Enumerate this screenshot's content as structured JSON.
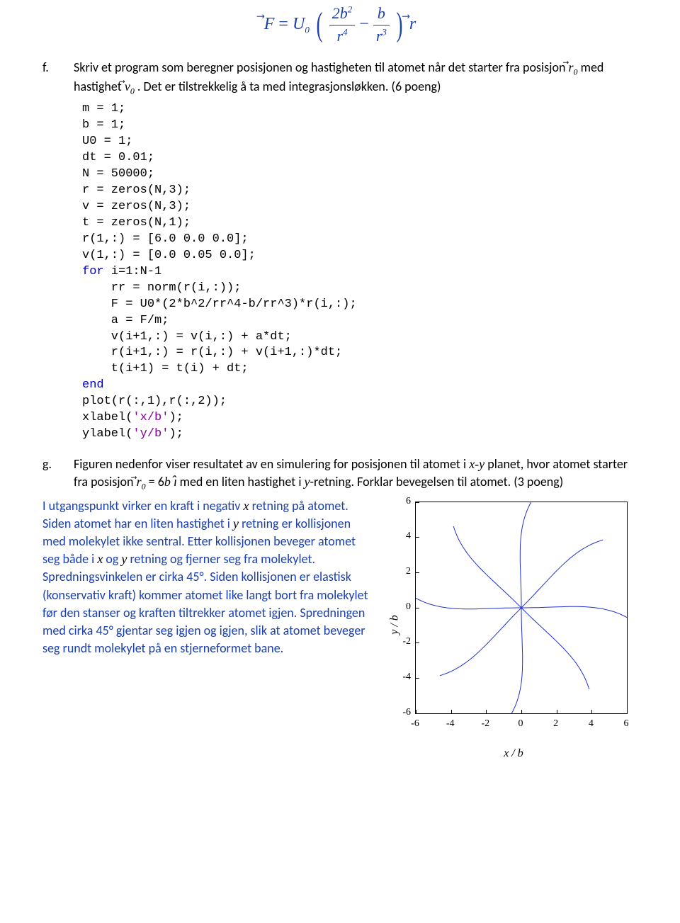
{
  "formula": {
    "lhs_var": "F",
    "coeff": "U",
    "coeff_sub": "0",
    "frac1_num": "2b",
    "frac1_num_sup": "2",
    "frac1_den_base": "r",
    "frac1_den_sup": "4",
    "frac2_num": "b",
    "frac2_den_base": "r",
    "frac2_den_sup": "3",
    "rhs_var": "r"
  },
  "item_f": {
    "letter": "f.",
    "text_1": "Skriv et program som beregner posisjonen og hastigheten til atomet når det starter fra posisjon ",
    "r_sym": "r",
    "r_sub": "0",
    "text_2": " med hastighet ",
    "v_sym": "v",
    "v_sub": "0",
    "text_3": ". Det er tilstrekkelig å ta med integrasjonsløkken. (6 poeng)"
  },
  "code": {
    "lines": [
      {
        "t": "m = 1;"
      },
      {
        "t": "b = 1;"
      },
      {
        "t": "U0 = 1;"
      },
      {
        "t": "dt = 0.01;"
      },
      {
        "t": "N = 50000;"
      },
      {
        "t": "r = zeros(N,3);"
      },
      {
        "t": "v = zeros(N,3);"
      },
      {
        "t": "t = zeros(N,1);"
      },
      {
        "t": "r(1,:) = [6.0 0.0 0.0];"
      },
      {
        "t": "v(1,:) = [0.0 0.05 0.0];"
      },
      {
        "pre": "",
        "kw": "for",
        "post": " i=1:N-1"
      },
      {
        "indent": 1,
        "t": "rr = norm(r(i,:));"
      },
      {
        "indent": 1,
        "t": "F = U0*(2*b^2/rr^4-b/rr^3)*r(i,:);"
      },
      {
        "indent": 1,
        "t": "a = F/m;"
      },
      {
        "indent": 1,
        "t": "v(i+1,:) = v(i,:) + a*dt;"
      },
      {
        "indent": 1,
        "t": "r(i+1,:) = r(i,:) + v(i+1,:)*dt;"
      },
      {
        "indent": 1,
        "t": "t(i+1) = t(i) + dt;"
      },
      {
        "kw": "end"
      },
      {
        "t": "plot(r(:,1),r(:,2));"
      },
      {
        "call": "xlabel(",
        "str": "'x/b'",
        "tail": ");"
      },
      {
        "call": "ylabel(",
        "str": "'y/b'",
        "tail": ");"
      }
    ]
  },
  "item_g": {
    "letter": "g.",
    "t1": "Figuren nedenfor viser resultatet av en simulering for posisjonen til atomet i ",
    "xy": "x-y",
    "t2": " planet, hvor atomet starter fra posisjon ",
    "r_sym": "r",
    "r_sub": "0",
    "eq_mid": " = 6",
    "b_sym": "b ",
    "hat_sym": "ı",
    "t3": " med en liten hastighet i ",
    "y_sym": "y",
    "t4": "-retning. Forklar bevegelsen til atomet. (3 poeng)"
  },
  "answer": {
    "p1a": "I utgangspunkt virker en kraft i negativ ",
    "x": "x",
    "p1b": " retning på atomet. Siden atomet har en liten hastighet i ",
    "y": "y",
    "p1c": " retning er kollisjonen med molekylet ikke sentral. Etter kollisjonen beveger atomet seg både i ",
    "x2": "x",
    "p1d": " og ",
    "y2": "y",
    "p1e": " retning og fjerner seg fra molekylet. Spredningsvinkelen er cirka 45°. Siden kollisjonen er elastisk (konservativ kraft) kommer atomet like langt bort fra molekylet før den stanser og kraften tiltrekker atomet igjen. Spredningen med cirka 45° gjentar seg igjen og igjen, slik at atomet beveger seg rundt molekylet på en stjerneformet bane."
  },
  "chart_data": {
    "type": "line",
    "title": "",
    "xlabel": "x / b",
    "ylabel": "y / b",
    "xlim": [
      -6,
      6
    ],
    "ylim": [
      -6,
      6
    ],
    "x_ticks": [
      -6,
      -4,
      -2,
      0,
      2,
      4,
      6
    ],
    "y_ticks": [
      -6,
      -4,
      -2,
      0,
      2,
      4,
      6
    ],
    "description": "Eight-petal star-like trajectory centered at origin, petals reaching r≈6, spaced ~45°",
    "petal_tips": [
      {
        "x": 6.0,
        "y": 0.0
      },
      {
        "x": 4.2,
        "y": 4.2
      },
      {
        "x": 0.0,
        "y": 6.0
      },
      {
        "x": -4.2,
        "y": 4.2
      },
      {
        "x": -6.0,
        "y": 0.0
      },
      {
        "x": -4.2,
        "y": -4.2
      },
      {
        "x": 0.0,
        "y": -6.0
      },
      {
        "x": 4.2,
        "y": -4.2
      }
    ]
  }
}
